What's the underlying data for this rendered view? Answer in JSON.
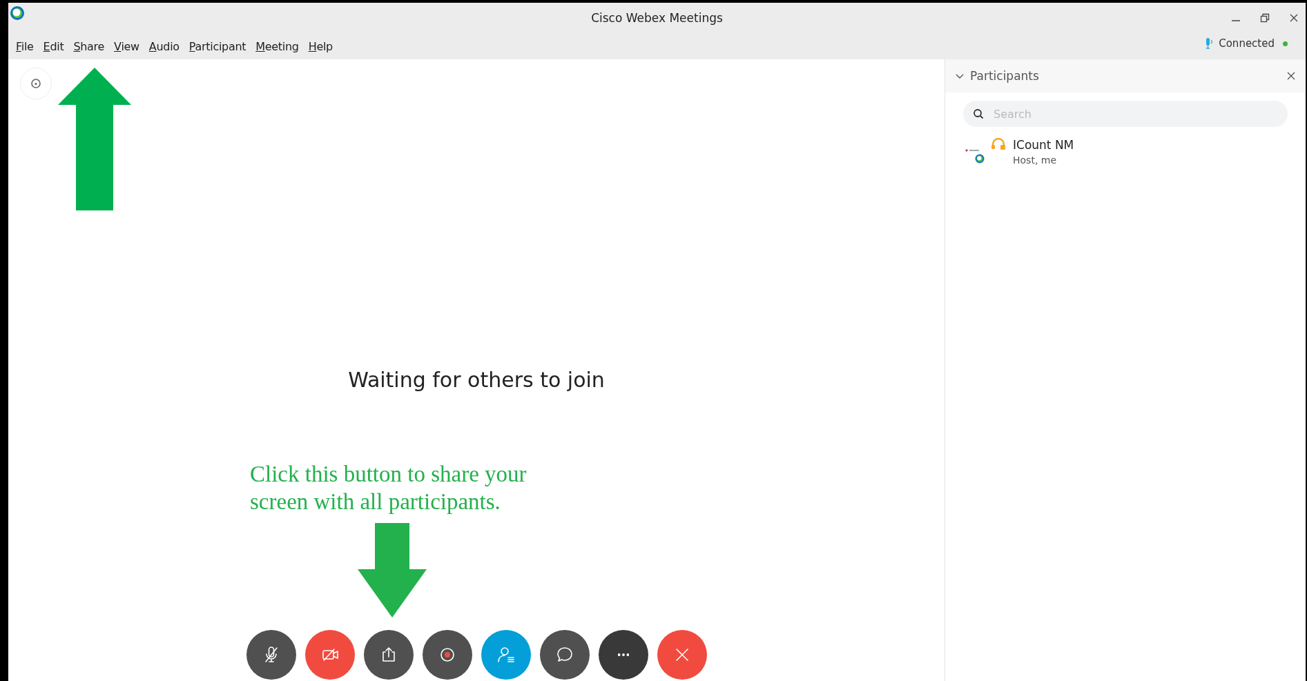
{
  "window": {
    "title": "Cisco Webex Meetings"
  },
  "menu": [
    {
      "label": "File"
    },
    {
      "label": "Edit"
    },
    {
      "label": "Share"
    },
    {
      "label": "View"
    },
    {
      "label": "Audio"
    },
    {
      "label": "Participant"
    },
    {
      "label": "Meeting"
    },
    {
      "label": "Help"
    }
  ],
  "status": {
    "label": "Connected",
    "connected": true
  },
  "stage": {
    "message": "Waiting for others to join"
  },
  "annotation": {
    "text": "Click this button to share your screen with all participants."
  },
  "toolbar": [
    {
      "kind": "mute",
      "color": "#505050"
    },
    {
      "kind": "video",
      "color": "#f14b40"
    },
    {
      "kind": "share",
      "color": "#505050"
    },
    {
      "kind": "record",
      "color": "#505050"
    },
    {
      "kind": "participants",
      "color": "#049fd9"
    },
    {
      "kind": "chat",
      "color": "#505050"
    },
    {
      "kind": "more",
      "color": "#393939"
    },
    {
      "kind": "leave",
      "color": "#f14b40"
    }
  ],
  "participants_panel": {
    "title": "Participants",
    "expanded": true,
    "search": {
      "placeholder": "Search"
    },
    "participants": [
      {
        "name": "ICount NM",
        "role": "Host, me"
      }
    ]
  }
}
